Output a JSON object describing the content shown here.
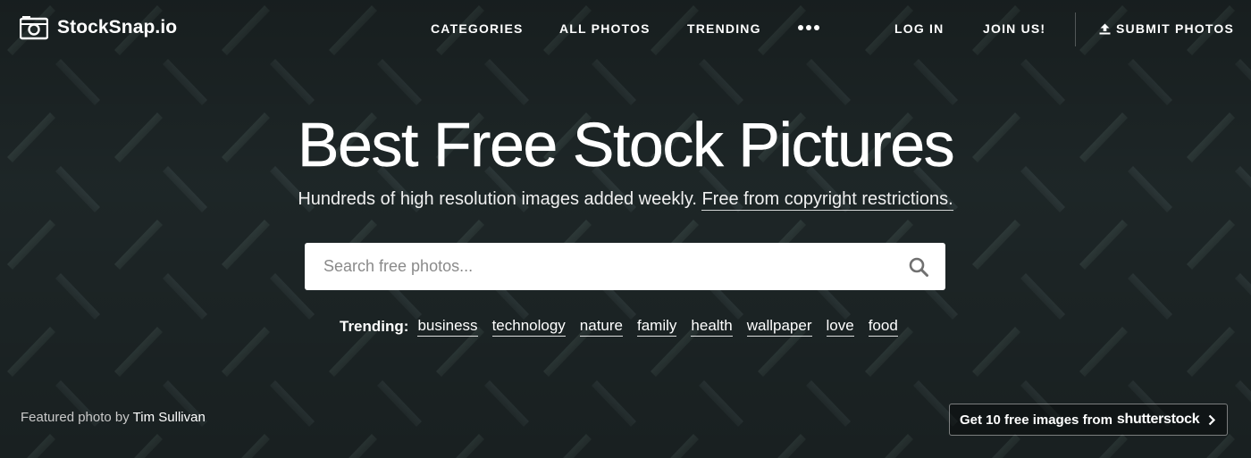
{
  "brand": {
    "name": "StockSnap.io",
    "icon": "camera-icon"
  },
  "nav": {
    "categories": "CATEGORIES",
    "all_photos": "ALL PHOTOS",
    "trending": "TRENDING",
    "more_icon": "more-dots-icon",
    "log_in": "LOG IN",
    "join": "JOIN US!",
    "submit": "SUBMIT PHOTOS",
    "submit_icon": "upload-icon"
  },
  "hero": {
    "headline": "Best Free Stock Pictures",
    "subline": "Hundreds of high resolution images added weekly.",
    "subline_link": "Free from copyright restrictions."
  },
  "search": {
    "placeholder": "Search free photos...",
    "value": "",
    "icon": "search-icon"
  },
  "trending": {
    "label": "Trending:",
    "tags": [
      "business",
      "technology",
      "nature",
      "family",
      "health",
      "wallpaper",
      "love",
      "food"
    ]
  },
  "credit": {
    "prefix": "Featured photo by",
    "author": "Tim Sullivan"
  },
  "promo": {
    "text": "Get 10 free images from",
    "brand": "shutterstock",
    "icon": "chevron-right-icon"
  },
  "colors": {
    "background": "#1c2527",
    "text": "#ffffff",
    "search_bg": "#ffffff",
    "placeholder": "#8a8a8a"
  }
}
